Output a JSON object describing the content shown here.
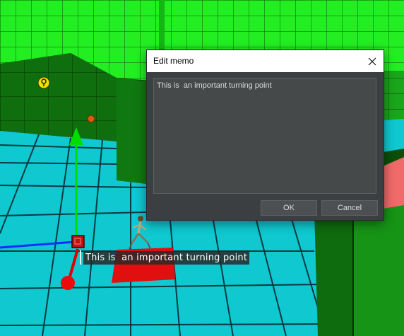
{
  "scene": {
    "memo_label": "This is  an important turning point"
  },
  "dialog": {
    "title": "Edit memo",
    "memo_text": "This is  an important turning point",
    "ok_label": "OK",
    "cancel_label": "Cancel"
  },
  "colors": {
    "floor": "#00c8d2",
    "wall_light": "#1ef01e",
    "wall_dark": "#0e5a0e",
    "dialog_bg": "#3c3f41",
    "gizmo_green": "#00dd00",
    "gizmo_red": "#dd0000",
    "gizmo_blue": "#1030ff"
  },
  "icons": [
    "close-icon",
    "waypoint-marker-icon",
    "orb-marker-icon",
    "player-character"
  ]
}
